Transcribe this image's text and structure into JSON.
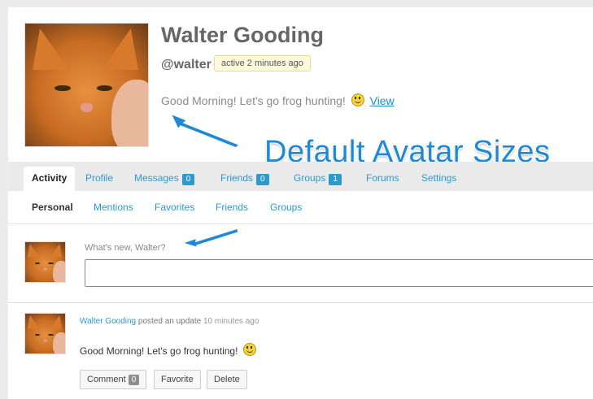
{
  "profile": {
    "name": "Walter Gooding",
    "handle": "@walter",
    "activity": "active 2 minutes ago",
    "status_text": "Good Morning! Let's go frog hunting!",
    "view_link": "View"
  },
  "overlay": {
    "title": "Default Avatar Sizes"
  },
  "tabs": [
    {
      "label": "Activity"
    },
    {
      "label": "Profile"
    },
    {
      "label": "Messages",
      "count": "0"
    },
    {
      "label": "Friends",
      "count": "0"
    },
    {
      "label": "Groups",
      "count": "1"
    },
    {
      "label": "Forums"
    },
    {
      "label": "Settings"
    }
  ],
  "subnav": [
    {
      "label": "Personal"
    },
    {
      "label": "Mentions"
    },
    {
      "label": "Favorites"
    },
    {
      "label": "Friends"
    },
    {
      "label": "Groups"
    }
  ],
  "post_form": {
    "prompt": "What's new, Walter?"
  },
  "activity_item": {
    "author": "Walter Gooding",
    "action": "posted an update",
    "time": "10 minutes ago",
    "text": "Good Morning! Let's go frog hunting!",
    "buttons": {
      "comment": "Comment",
      "comment_count": "0",
      "favorite": "Favorite",
      "delete": "Delete"
    }
  },
  "colors": {
    "link": "#2a9ad0",
    "overlay_text": "#1e88d9",
    "badge_bg": "#fff9db"
  },
  "icons": {
    "smiley": "smiley-icon",
    "arrow": "blue-arrow-annotation"
  }
}
